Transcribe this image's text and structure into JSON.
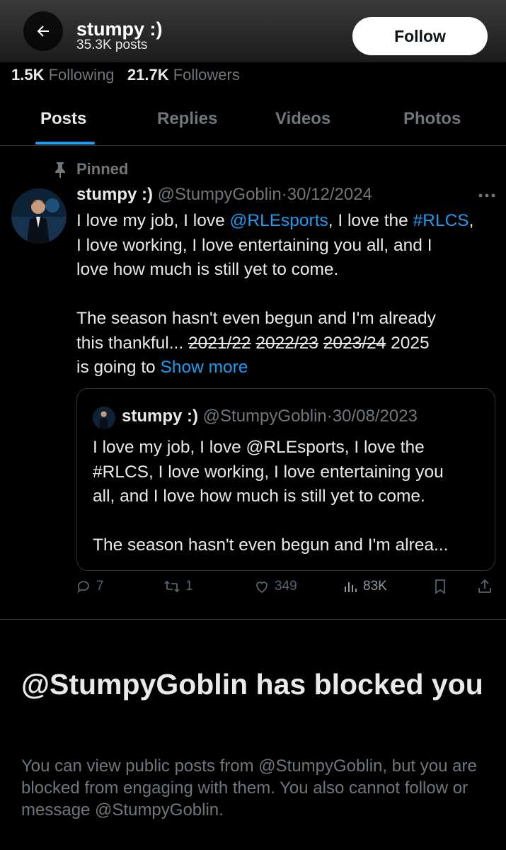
{
  "header": {
    "name": "stumpy :)",
    "posts_count": "35.3K posts",
    "follow_label": "Follow"
  },
  "stats": {
    "following_count": "1.5K",
    "following_label": "Following",
    "followers_count": "21.7K",
    "followers_label": "Followers"
  },
  "tabs": [
    {
      "label": "Posts",
      "active": true
    },
    {
      "label": "Replies",
      "active": false
    },
    {
      "label": "Videos",
      "active": false
    },
    {
      "label": "Photos",
      "active": false
    }
  ],
  "pinned_tweet": {
    "pinned_label": "Pinned",
    "display_name": "stumpy :)",
    "handle": "@StumpyGoblin",
    "date": "30/12/2024",
    "separator": "·",
    "body": {
      "l1_a": "I love my job, I love ",
      "l1_mention": "@RLEsports",
      "l1_b": ", I love the ",
      "l1_hashtag": "#RLCS",
      "l1_c": ",",
      "l2": "I love working, I love entertaining you all, and I",
      "l3": "love how much is still yet to come.",
      "l4": "The season hasn't even begun and I'm already",
      "l5_a": "this thankful... ",
      "strike_1": "2021/22",
      "strike_2": "2022/23",
      "strike_3": "2023/24",
      "l5_b": "2025",
      "l6_a": "is going to ",
      "show_more": "Show more"
    },
    "quote": {
      "display_name": "stumpy :)",
      "handle": "@StumpyGoblin",
      "date": "30/08/2023",
      "separator": "·",
      "lines": [
        "I love my job, I love @RLEsports, I love the",
        "#RLCS, I love working, I love entertaining you",
        "all, and I love how much is still yet to come.",
        "The season hasn't even begun and I'm alrea..."
      ]
    },
    "actions": {
      "replies": "7",
      "reposts": "1",
      "likes": "349",
      "views": "83K"
    }
  },
  "blocked": {
    "title": "@StumpyGoblin has blocked you",
    "description": "You can view public posts from @StumpyGoblin, but you are blocked from engaging with them. You also cannot follow or message @StumpyGoblin."
  },
  "colors": {
    "accent": "#1d9bf0",
    "background": "#000000",
    "muted_text": "#71767b",
    "primary_text": "#e7e9ea"
  },
  "icons": {
    "back": "arrow-left-icon",
    "pin": "pin-icon",
    "more": "more-horizontal-icon",
    "reply": "reply-icon",
    "repost": "repost-icon",
    "like": "heart-icon",
    "views": "views-icon",
    "bookmark": "bookmark-icon",
    "share": "share-icon"
  }
}
